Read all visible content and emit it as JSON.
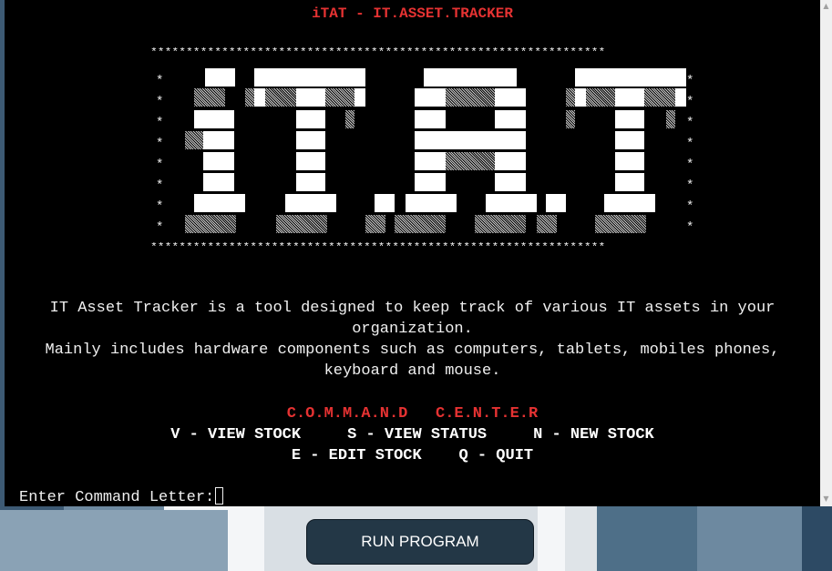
{
  "terminal": {
    "title": "iTAT - IT.ASSET.TRACKER",
    "banner_border": "****************************************************************",
    "banner_art_text": "IT.A.T",
    "description": "IT Asset Tracker is a tool designed to keep track of various IT assets in your\norganization.\nMainly includes hardware components such as computers, tablets, mobiles phones,\nkeyboard and mouse.",
    "command_center_heading": "C.O.M.M.A.N.D   C.E.N.T.E.R",
    "commands_line_1": "V - VIEW STOCK     S - VIEW STATUS     N - NEW STOCK",
    "commands_line_2": "E - EDIT STOCK    Q - QUIT",
    "prompt": "Enter Command Letter:",
    "input_value": ""
  },
  "run_button": {
    "label": "RUN PROGRAM"
  },
  "colors": {
    "terminal_bg": "#000000",
    "title_red": "#e53232",
    "text": "#f0f0f0",
    "button_bg": "#233746"
  },
  "icons": {
    "scroll_up": "scroll-up-arrow-icon",
    "scroll_down": "scroll-down-arrow-icon"
  }
}
